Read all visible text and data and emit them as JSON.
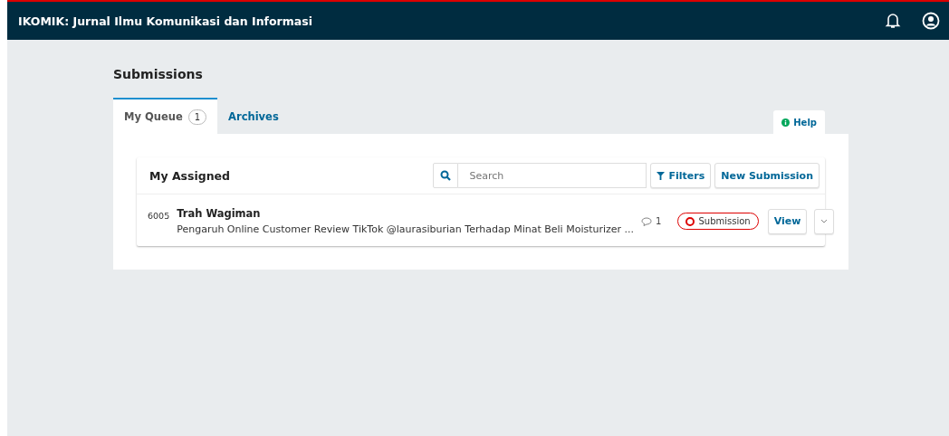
{
  "header": {
    "title": "IKOMIK: Jurnal Ilmu Komunikasi dan Informasi"
  },
  "page_title": "Submissions",
  "tabs": [
    {
      "label": "My Queue",
      "count": "1",
      "selected": true
    },
    {
      "label": "Archives",
      "selected": false
    }
  ],
  "help": {
    "label": "Help"
  },
  "list": {
    "title": "My Assigned",
    "search": {
      "placeholder": "Search"
    },
    "buttons": [
      "Filters",
      "New Submission"
    ],
    "items": [
      {
        "id": "6005",
        "author": "Trah Wagiman",
        "title": "Pengaruh Online Customer Review TikTok @laurasiburian Terhadap Minat Beli Moisturizer ...",
        "comments": "1",
        "stage": "Submission",
        "action": "View"
      }
    ]
  }
}
